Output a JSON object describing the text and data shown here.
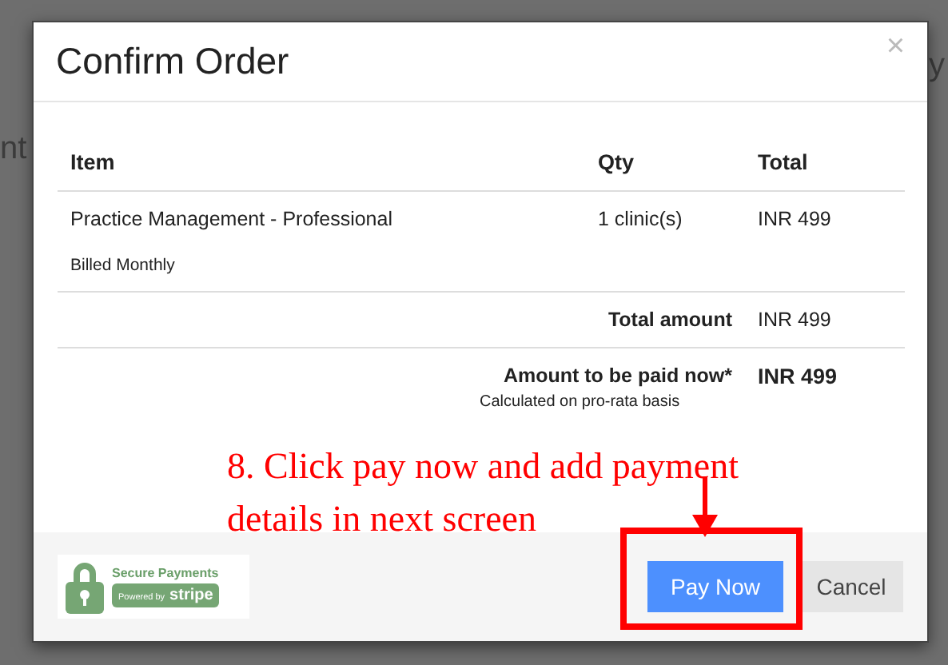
{
  "background": {
    "fragments": [
      "nt",
      "y"
    ]
  },
  "dialog": {
    "title": "Confirm Order",
    "close": "×",
    "table": {
      "columns": [
        "Item",
        "Qty",
        "Total"
      ],
      "rows": [
        {
          "item": "Practice Management - Professional",
          "note": "Billed Monthly",
          "qty": "1 clinic(s)",
          "total": "INR 499"
        }
      ],
      "total": {
        "label": "Total amount",
        "value": "INR 499"
      },
      "due": {
        "label": "Amount to be paid now*",
        "value": "INR 499",
        "note": "Calculated on pro-rata basis"
      }
    },
    "badge": {
      "title": "Secure Payments",
      "powered": "Powered by",
      "brand": "stripe"
    },
    "buttons": [
      {
        "label": "Pay Now",
        "kind": "primary"
      },
      {
        "label": "Cancel",
        "kind": "secondary"
      }
    ]
  },
  "annotation": {
    "lines": [
      "8. Click pay now and add payment",
      "details in next screen"
    ]
  }
}
